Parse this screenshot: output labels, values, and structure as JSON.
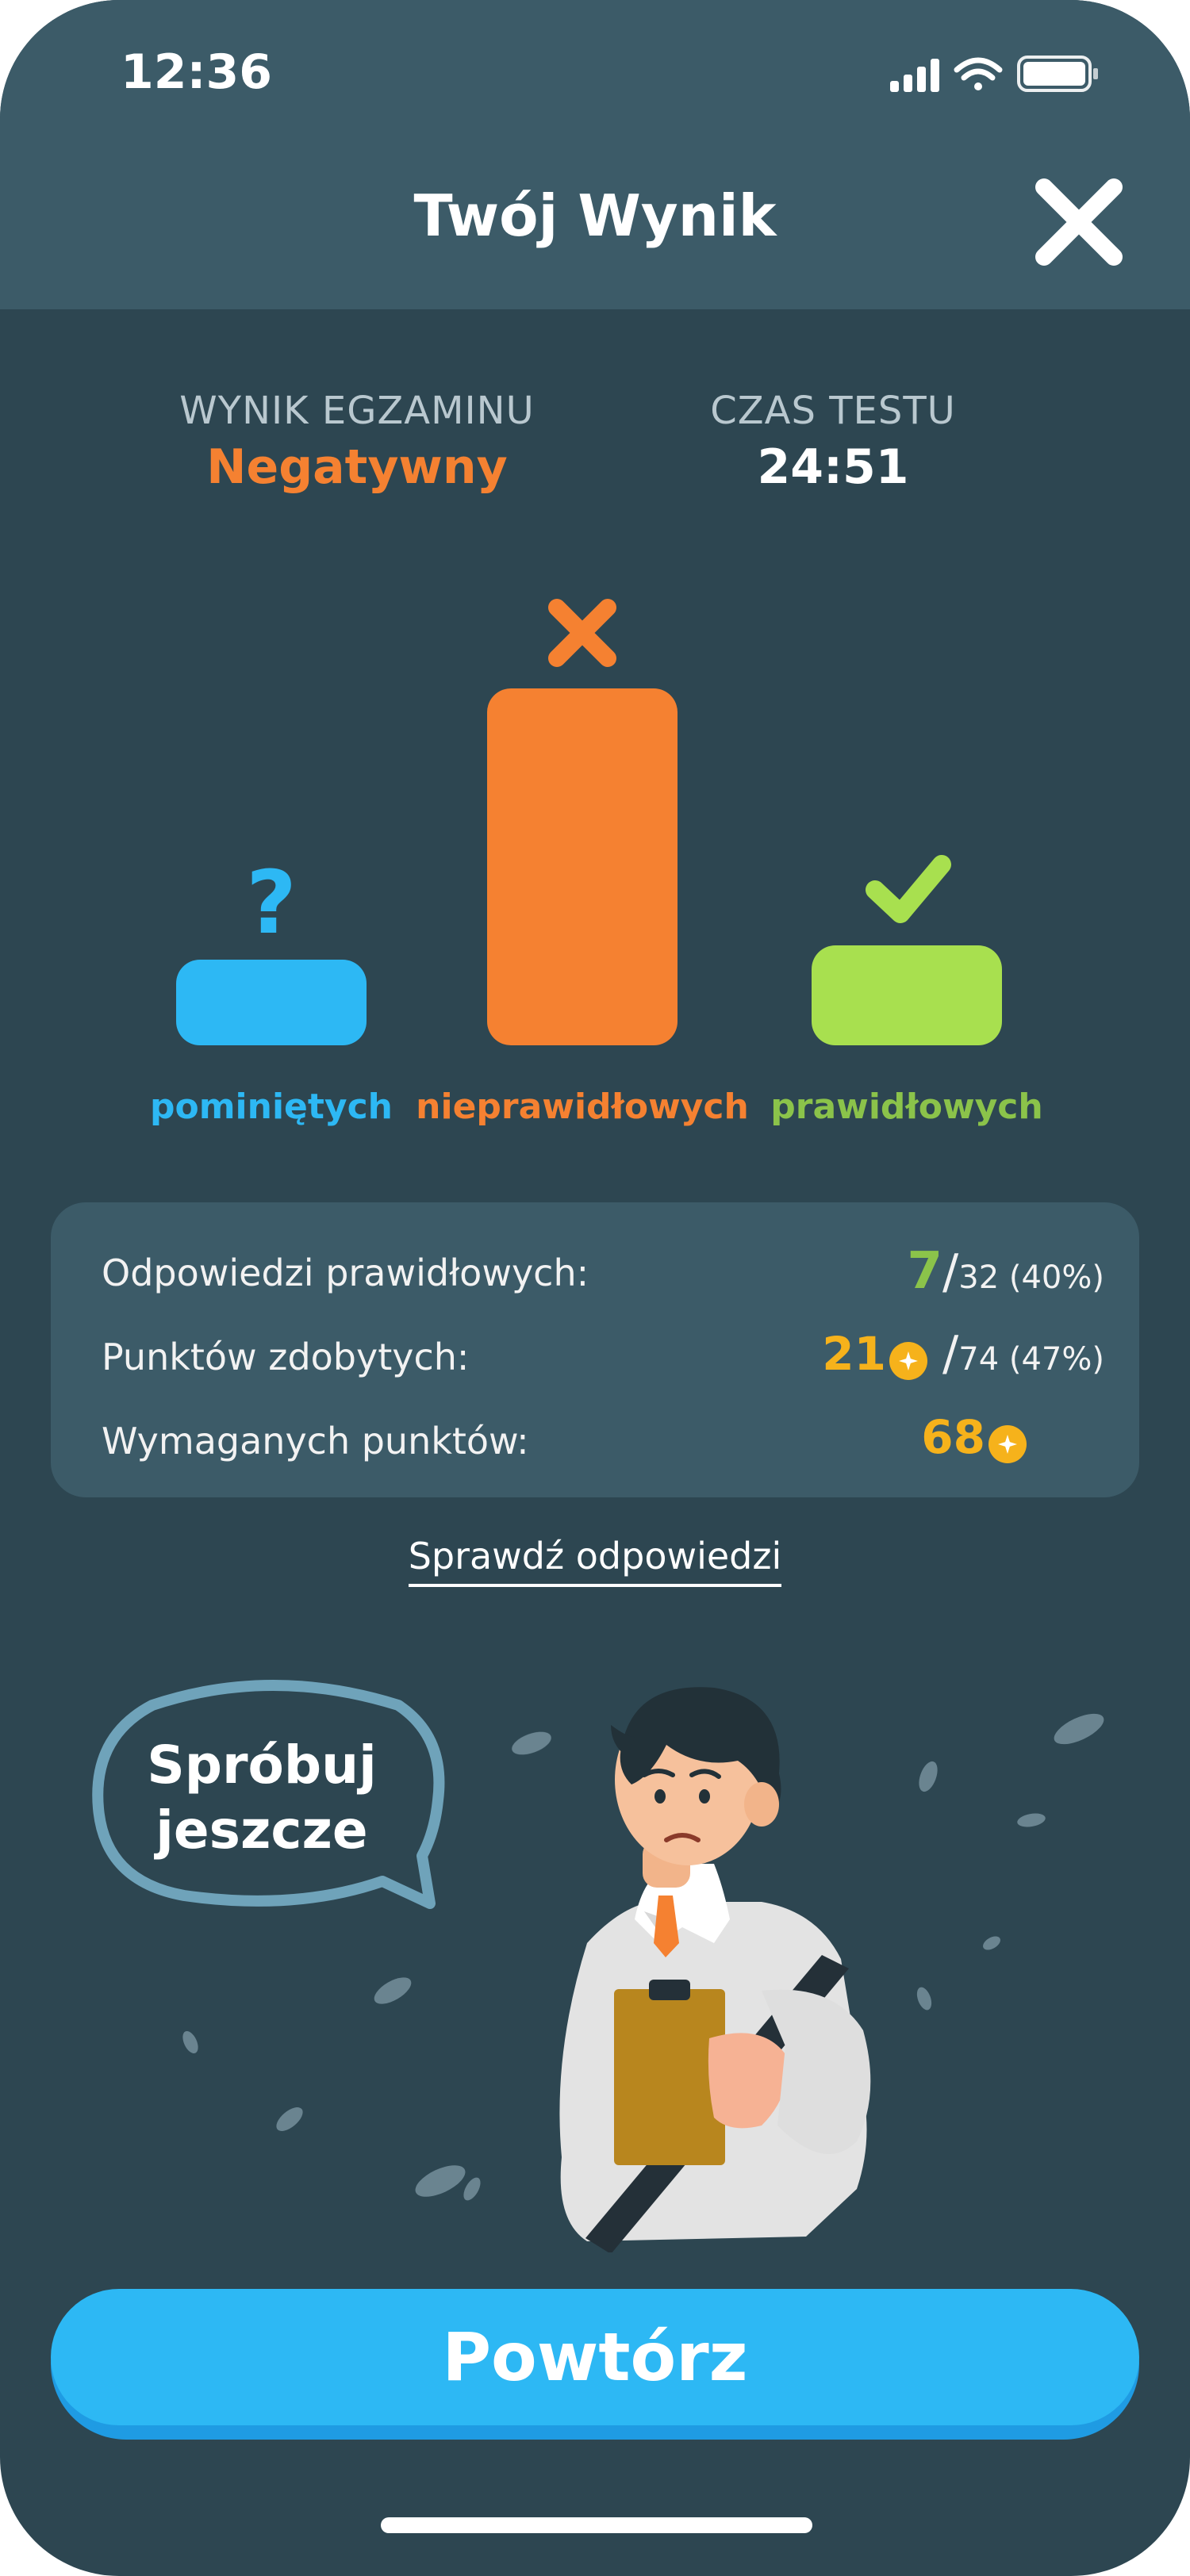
{
  "status_bar": {
    "time": "12:36"
  },
  "header": {
    "title": "Twój Wynik"
  },
  "exam": {
    "result_label": "WYNIK EGZAMINU",
    "result_value": "Negatywny",
    "time_label": "CZAS TESTU",
    "time_value": "24:51"
  },
  "chart_data": {
    "type": "bar",
    "categories": [
      "pominiętych",
      "nieprawidłowych",
      "prawidłowych"
    ],
    "values": [
      0,
      25,
      7
    ],
    "colors": [
      "#2db8f4",
      "#f58131",
      "#a8e04f"
    ],
    "markers": [
      "?",
      "x-icon",
      "check-icon"
    ]
  },
  "summary": {
    "correct_label": "Odpowiedzi prawidłowych:",
    "correct_value": "7",
    "correct_total": "32 (40%)",
    "points_label": "Punktów zdobytych:",
    "points_value": "21",
    "points_total": "74 (47%)",
    "required_label": "Wymaganych punktów:",
    "required_value": "68"
  },
  "review_link": "Sprawdź odpowiedzi",
  "speech_bubble": {
    "line1": "Spróbuj",
    "line2": "jeszcze"
  },
  "repeat_button": "Powtórz",
  "colors": {
    "background": "#2d4651",
    "header": "#3c5b68",
    "negative": "#f58131",
    "positive": "#8bc34a",
    "skipped": "#2db8f4",
    "points": "#f6b21b",
    "button": "#2db8f4"
  }
}
